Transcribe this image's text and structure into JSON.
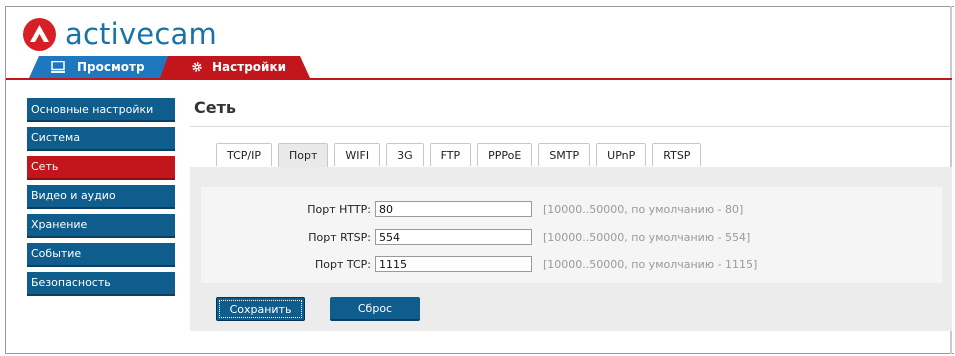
{
  "app": {
    "logo_text": "activecam",
    "brand_red": "#c3151c",
    "brand_blue": "#1d78c0",
    "nav_blue": "#0f5d8c"
  },
  "header_tabs": [
    {
      "label": "Просмотр",
      "icon": "monitor-icon",
      "active": false
    },
    {
      "label": "Настройки",
      "icon": "gear-icon",
      "active": true
    }
  ],
  "sidebar": {
    "items": [
      {
        "label": "Основные настройки",
        "active": false
      },
      {
        "label": "Система",
        "active": false
      },
      {
        "label": "Сеть",
        "active": true
      },
      {
        "label": "Видео и аудио",
        "active": false
      },
      {
        "label": "Хранение",
        "active": false
      },
      {
        "label": "Событие",
        "active": false
      },
      {
        "label": "Безопасность",
        "active": false
      }
    ]
  },
  "main": {
    "title": "Сеть",
    "subtabs": [
      {
        "label": "TCP/IP",
        "active": false
      },
      {
        "label": "Порт",
        "active": true
      },
      {
        "label": "WIFI",
        "active": false
      },
      {
        "label": "3G",
        "active": false
      },
      {
        "label": "FTP",
        "active": false
      },
      {
        "label": "PPPoE",
        "active": false
      },
      {
        "label": "SMTP",
        "active": false
      },
      {
        "label": "UPnP",
        "active": false
      },
      {
        "label": "RTSP",
        "active": false
      }
    ],
    "fields": [
      {
        "label": "Порт HTTP:",
        "value": "80",
        "hint": "[10000..50000, по умолчанию - 80]"
      },
      {
        "label": "Порт RTSP:",
        "value": "554",
        "hint": "[10000..50000, по умолчанию - 554]"
      },
      {
        "label": "Порт TCP:",
        "value": "1115",
        "hint": "[10000..50000, по умолчанию - 1115]"
      }
    ],
    "save_label": "Сохранить",
    "reset_label": "Сброс"
  }
}
